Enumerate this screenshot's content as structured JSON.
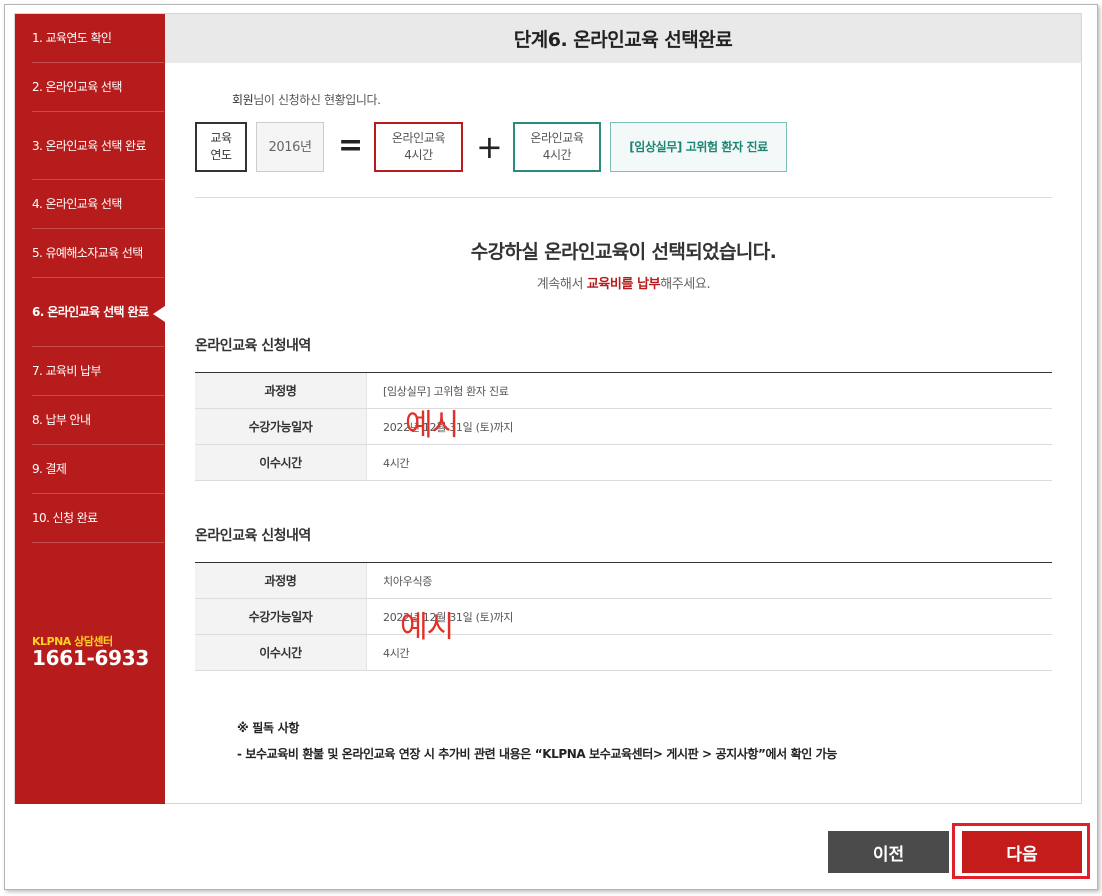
{
  "sidebar": {
    "items": [
      {
        "label": "1. 교육연도 확인"
      },
      {
        "label": "2. 온라인교육 선택"
      },
      {
        "label": "3. 온라인교육 선택 완료"
      },
      {
        "label": "4. 온라인교육 선택"
      },
      {
        "label": "5. 유예해소자교육 선택"
      },
      {
        "label": "6. 온라인교육 선택 완료"
      },
      {
        "label": "7. 교육비 납부"
      },
      {
        "label": "8. 납부 안내"
      },
      {
        "label": "9. 결제"
      },
      {
        "label": "10. 신청 완료"
      }
    ],
    "active_index": 5,
    "cs_label": "KLPNA 상담센터",
    "cs_phone": "1661-6933"
  },
  "header": {
    "title": "단계6. 온라인교육 선택완료"
  },
  "intro": {
    "name": "회원",
    "suffix": "님이 신청하신 현황입니다."
  },
  "summary": {
    "label_line1": "교육",
    "label_line2": "연도",
    "year": "2016년",
    "eq": "=",
    "red_line1": "온라인교육",
    "red_line2": "4시간",
    "plus": "+",
    "teal_line1": "온라인교육",
    "teal_line2": "4시간",
    "course": "[임상실무] 고위험 환자 진료"
  },
  "done": {
    "title": "수강하실 온라인교육이 선택되었습니다.",
    "sub_prefix": "계속해서 ",
    "sub_highlight": "교육비를 납부",
    "sub_suffix": "해주세요."
  },
  "sections": [
    {
      "title": "온라인교육 신청내역",
      "rows": [
        {
          "th": "과정명",
          "td": "[임상실무] 고위험 환자 진료"
        },
        {
          "th": "수강가능일자",
          "td": "2022년 12월 31일 (토)까지"
        },
        {
          "th": "이수시간",
          "td": "4시간"
        }
      ],
      "watermark": "예시"
    },
    {
      "title": "온라인교육 신청내역",
      "rows": [
        {
          "th": "과정명",
          "td": "치아우식증"
        },
        {
          "th": "수강가능일자",
          "td": "2022년 12월 31일 (토)까지"
        },
        {
          "th": "이수시간",
          "td": "4시간"
        }
      ],
      "watermark": "예시"
    }
  ],
  "notice": {
    "title": "※ 필독 사항",
    "body": "- 보수교육비 환불 및 온라인교육 연장 시 추가비 관련 내용은 “KLPNA 보수교육센터> 게시판 > 공지사항”에서 확인 가능"
  },
  "buttons": {
    "prev": "이전",
    "next": "다음"
  },
  "colors": {
    "brand_red": "#b71c1c",
    "teal": "#2a8c80",
    "highlight_border": "#e0202a"
  }
}
